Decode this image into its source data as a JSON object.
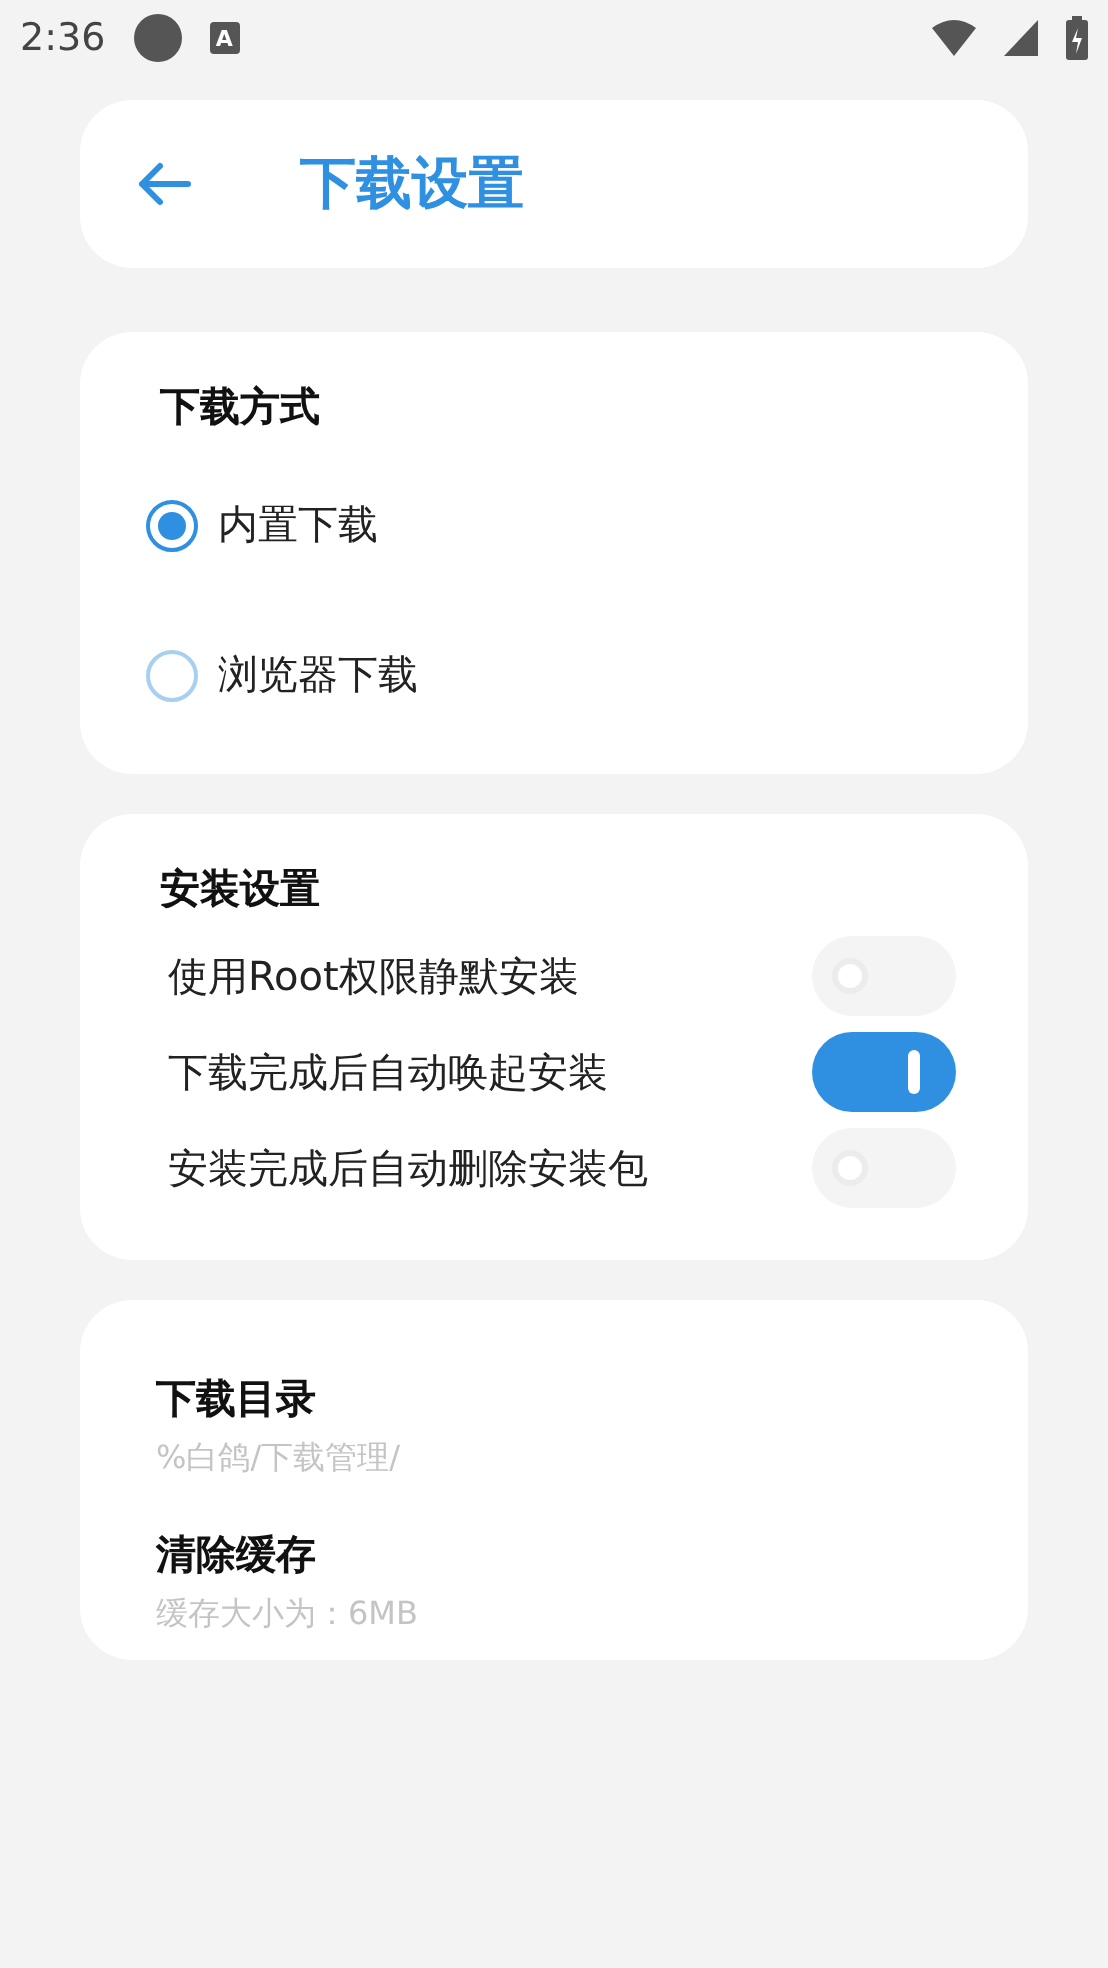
{
  "status_bar": {
    "time": "2:36",
    "notification_glyph": "A"
  },
  "header": {
    "title": "下载设置"
  },
  "download_method": {
    "title": "下载方式",
    "options": [
      {
        "label": "内置下载",
        "selected": true
      },
      {
        "label": "浏览器下载",
        "selected": false
      }
    ]
  },
  "install_settings": {
    "title": "安装设置",
    "toggles": [
      {
        "label": "使用Root权限静默安装",
        "on": false
      },
      {
        "label": "下载完成后自动唤起安装",
        "on": true
      },
      {
        "label": "安装完成后自动删除安装包",
        "on": false
      }
    ]
  },
  "storage": {
    "items": [
      {
        "title": "下载目录",
        "subtitle": "%白鸽/下载管理/"
      },
      {
        "title": "清除缓存",
        "subtitle": "缓存大小为：6MB"
      }
    ]
  }
}
